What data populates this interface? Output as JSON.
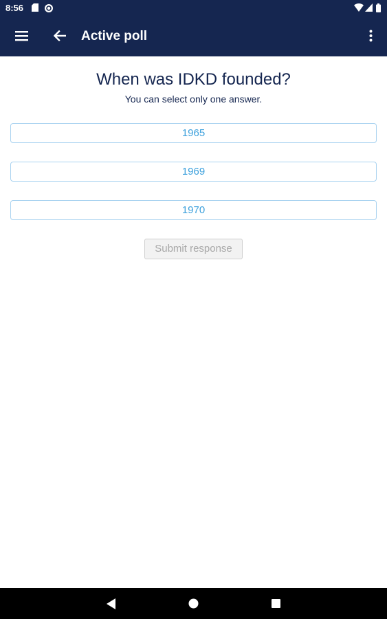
{
  "status_bar": {
    "time": "8:56",
    "icons": [
      "sd-card-icon",
      "sync-icon",
      "wifi-icon",
      "signal-icon",
      "battery-icon"
    ]
  },
  "app_bar": {
    "title": "Active poll",
    "icons": [
      "menu-icon",
      "back-arrow-icon",
      "more-vert-icon"
    ]
  },
  "poll": {
    "question": "When was IDKD founded?",
    "instruction": "You can select only one answer.",
    "options": [
      "1965",
      "1969",
      "1970"
    ],
    "submit_label": "Submit response"
  },
  "nav_bar": {
    "icons": [
      "back-triangle-icon",
      "home-circle-icon",
      "recents-square-icon"
    ]
  },
  "colors": {
    "primary": "#152650",
    "option_border": "#a8d2f0",
    "option_text": "#3ca0dc",
    "disabled_text": "#a8a8a8",
    "disabled_bg": "#f2f2f2"
  }
}
